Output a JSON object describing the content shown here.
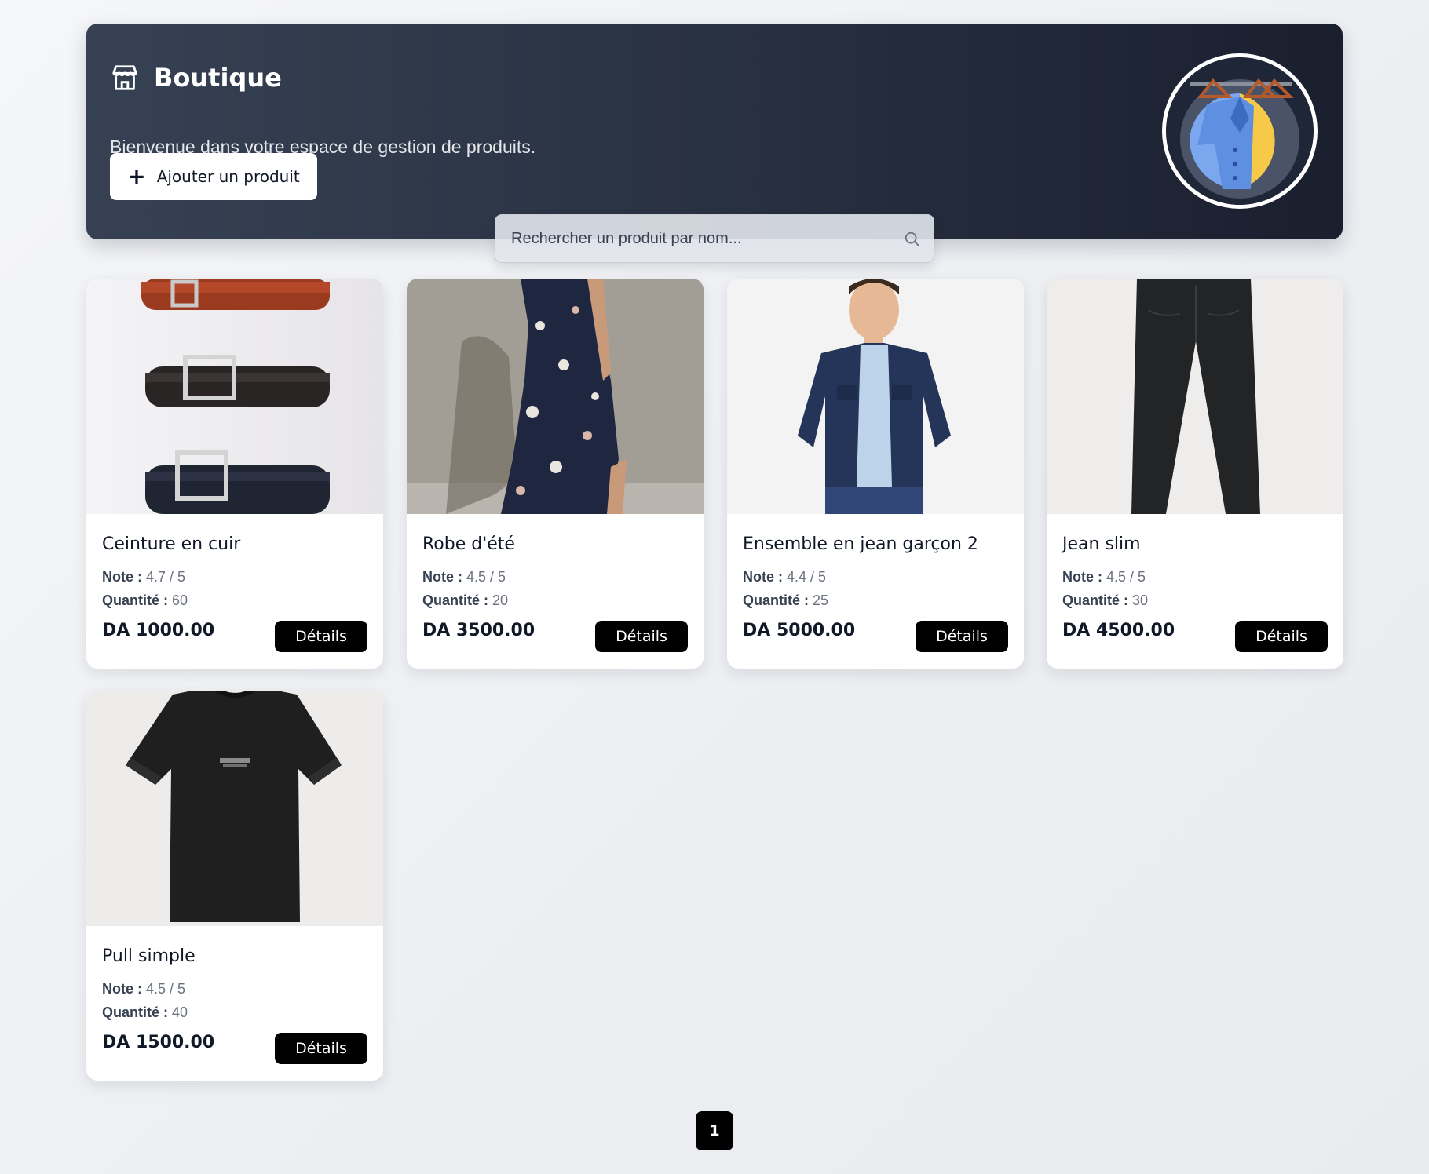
{
  "header": {
    "title": "Boutique",
    "subtitle": "Bienvenue dans votre espace de gestion de produits.",
    "add_button_label": "Ajouter un produit",
    "store_icon": "store-icon",
    "badge_icon": "wardrobe-icon"
  },
  "search": {
    "placeholder": "Rechercher un produit par nom...",
    "icon": "search-icon"
  },
  "labels": {
    "note": "Note :",
    "quantity": "Quantité :",
    "details": "Détails"
  },
  "products": [
    {
      "name": "Ceinture en cuir",
      "rating": "4.7 / 5",
      "quantity": "60",
      "price": "DA 1000.00",
      "image": "leather-belts"
    },
    {
      "name": "Robe d'été",
      "rating": "4.5 / 5",
      "quantity": "20",
      "price": "DA 3500.00",
      "image": "floral-dress"
    },
    {
      "name": "Ensemble en jean garçon 2",
      "rating": "4.4 / 5",
      "quantity": "25",
      "price": "DA 5000.00",
      "image": "boy-denim-jacket"
    },
    {
      "name": "Jean slim",
      "rating": "4.5 / 5",
      "quantity": "30",
      "price": "DA 4500.00",
      "image": "black-slim-jeans"
    },
    {
      "name": "Pull simple",
      "rating": "4.5 / 5",
      "quantity": "40",
      "price": "DA 1500.00",
      "image": "black-tshirt"
    }
  ],
  "pagination": {
    "current_page": "1"
  },
  "colors": {
    "banner_start": "#364153",
    "banner_end": "#1a1f2e",
    "button_dark": "#000000",
    "page_bg": "#eceef2"
  }
}
